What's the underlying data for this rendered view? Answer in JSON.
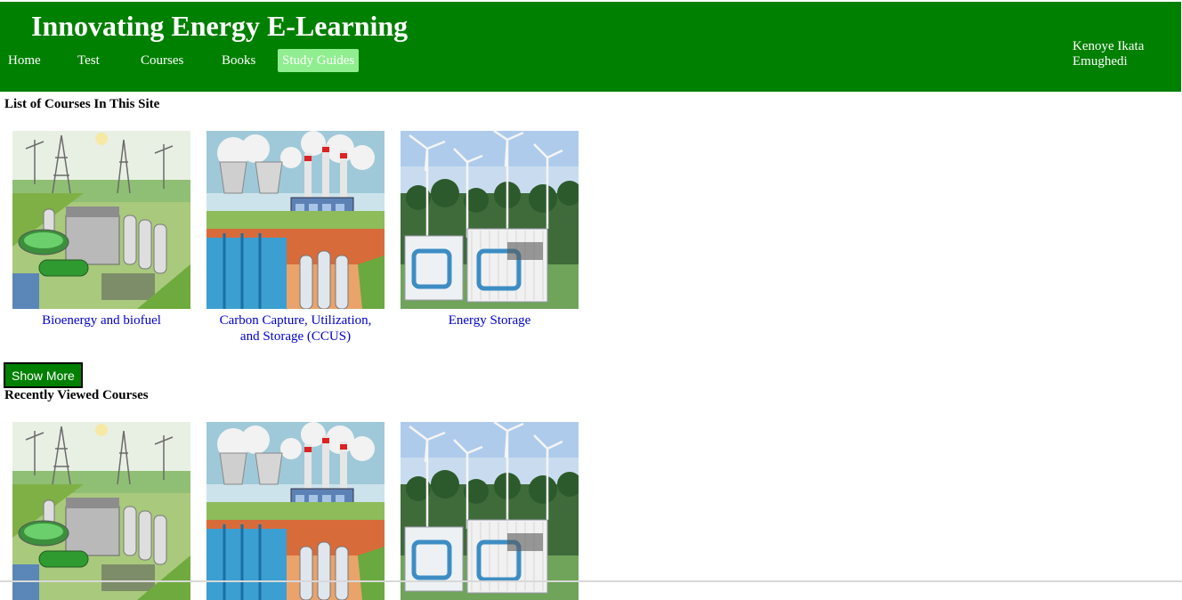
{
  "header": {
    "title": "Innovating Energy E-Learning",
    "nav": [
      "Home",
      "Test",
      "Courses",
      "Books",
      "Study Guides"
    ],
    "active_nav": "Study Guides",
    "user_name": "Kenoye Ikata Emughedi"
  },
  "courses_section": {
    "heading": "List of Courses In This Site",
    "courses": [
      {
        "title": "Bioenergy and biofuel",
        "image": "bioenergy-plant-illustration"
      },
      {
        "title": "Carbon Capture, Utilization, and Storage (CCUS)",
        "image": "carbon-capture-plant-illustration"
      },
      {
        "title": "Energy Storage",
        "image": "battery-containers-wind-turbines-photo"
      }
    ]
  },
  "show_more_label": "Show More",
  "recent_section": {
    "heading": "Recently Viewed Courses",
    "courses": [
      {
        "image": "bioenergy-plant-illustration"
      },
      {
        "image": "carbon-capture-plant-illustration"
      },
      {
        "image": "battery-containers-wind-turbines-photo"
      }
    ]
  },
  "colors": {
    "header_bg": "#008000",
    "active_nav_bg": "#90ee90",
    "link": "#0000cc"
  }
}
